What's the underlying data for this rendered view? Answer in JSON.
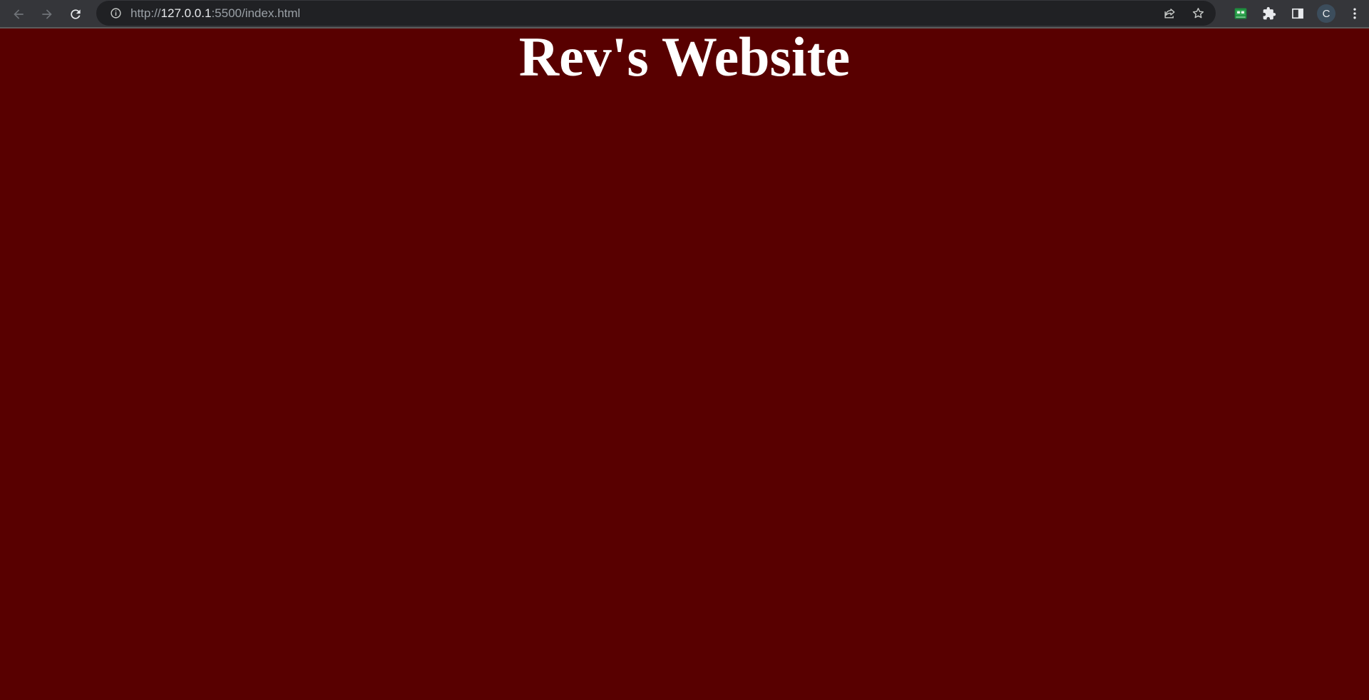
{
  "browser": {
    "url_scheme": "http://",
    "url_host": "127.0.0.1",
    "url_path": ":5500/index.html",
    "profile_initial": "C"
  },
  "page": {
    "title": "Rev's Website",
    "background_color": "#580000",
    "title_color": "#ffffff"
  },
  "icons": {
    "back": "arrow-left-icon",
    "forward": "arrow-right-icon",
    "reload": "reload-icon",
    "info": "info-icon",
    "share": "share-icon",
    "bookmark": "star-icon",
    "extension_green": "extension-badge-icon",
    "extensions": "puzzle-icon",
    "side_panel": "side-panel-icon",
    "menu": "kebab-menu-icon"
  }
}
